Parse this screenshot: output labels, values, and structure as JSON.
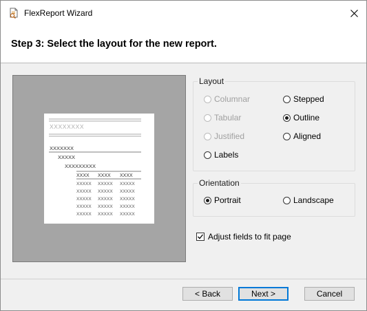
{
  "window": {
    "title": "FlexReport Wizard"
  },
  "header": {
    "step_title": "Step 3: Select the layout for the new report."
  },
  "layout": {
    "label": "Layout",
    "options": [
      {
        "label": "Columnar",
        "checked": false,
        "enabled": false
      },
      {
        "label": "Stepped",
        "checked": false,
        "enabled": true
      },
      {
        "label": "Tabular",
        "checked": false,
        "enabled": false
      },
      {
        "label": "Outline",
        "checked": true,
        "enabled": true
      },
      {
        "label": "Justified",
        "checked": false,
        "enabled": false
      },
      {
        "label": "Aligned",
        "checked": false,
        "enabled": true
      },
      {
        "label": "Labels",
        "checked": false,
        "enabled": true
      }
    ]
  },
  "orientation": {
    "label": "Orientation",
    "options": [
      {
        "label": "Portrait",
        "checked": true
      },
      {
        "label": "Landscape",
        "checked": false
      }
    ]
  },
  "fit": {
    "label": "Adjust fields to fit page",
    "checked": true
  },
  "preview": {
    "title_placeholder": "XXXXXXXX",
    "level1": "XXXXXXX",
    "level2": "XXXXX",
    "level3": "XXXXXXXXX",
    "col_header": "XXXX",
    "cell": "XXXXX"
  },
  "buttons": {
    "back": "< Back",
    "next": "Next >",
    "cancel": "Cancel"
  }
}
